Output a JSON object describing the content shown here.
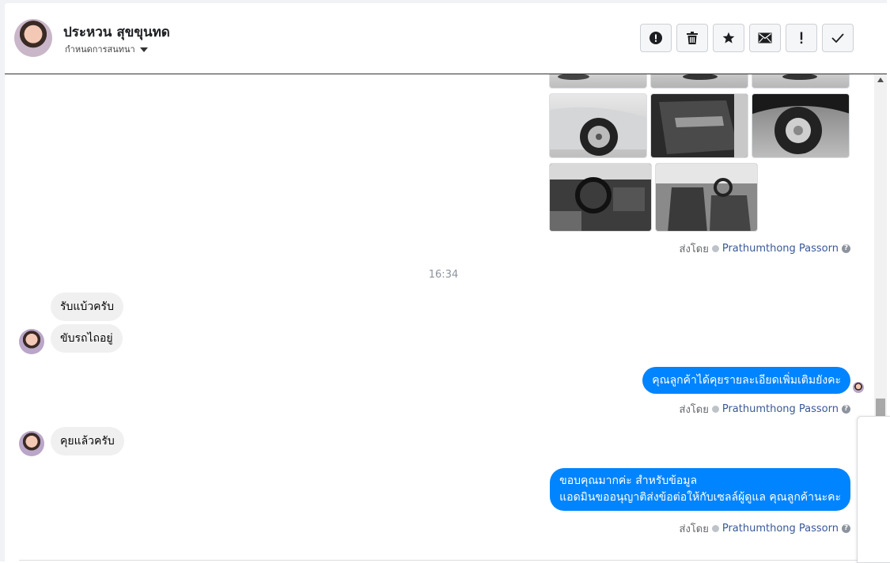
{
  "contact": {
    "name": "ประหวน สุขขุนทด",
    "subtitle": "กำหนดการสนทนา"
  },
  "toolbar": {
    "buttons": [
      {
        "name": "report-spam",
        "icon": "alert-circle-icon"
      },
      {
        "name": "delete",
        "icon": "trash-icon"
      },
      {
        "name": "star",
        "icon": "star-icon"
      },
      {
        "name": "mark-unread",
        "icon": "envelope-icon"
      },
      {
        "name": "important",
        "icon": "exclamation-icon"
      },
      {
        "name": "done",
        "icon": "check-icon"
      }
    ]
  },
  "conversation": {
    "photo_attachments": [
      {
        "label": "car exterior top 1"
      },
      {
        "label": "car exterior top 2"
      },
      {
        "label": "car exterior top 3"
      },
      {
        "label": "front wheel"
      },
      {
        "label": "door interior"
      },
      {
        "label": "rear wheel"
      },
      {
        "label": "dashboard"
      },
      {
        "label": "front seats"
      }
    ],
    "sent_by_prefix": "ส่งโดย",
    "sent_by_name": "Prathumthong Passorn",
    "timestamp": "16:34",
    "messages": [
      {
        "from": "customer",
        "text": "รับแบ้วครับ"
      },
      {
        "from": "customer",
        "text": "ขับรถไถอยู่"
      },
      {
        "from": "page",
        "text": "คุณลูกค้าได้คุยรายละเอียดเพิ่มเติมยังคะ"
      },
      {
        "from": "customer",
        "text": "คุยแล้วครับ"
      },
      {
        "from": "page",
        "text_line1": "ขอบคุณมากค่ะ สำหรับข้อมูล",
        "text_line2": "แอดมินขออนุญาติส่งข้อต่อให้กับเซลล์ผู้ดูแล คุณลูกค้านะคะ"
      }
    ]
  },
  "colors": {
    "outgoing_bubble": "#0084ff",
    "incoming_bubble": "#f0f0f0",
    "sender_link": "#385898"
  }
}
